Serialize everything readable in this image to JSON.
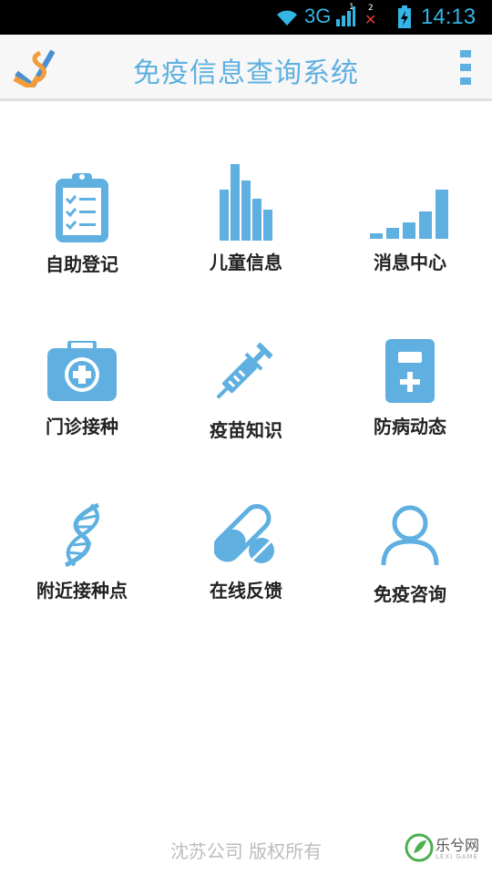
{
  "status_bar": {
    "network": "3G",
    "time": "14:13",
    "sim1": "1",
    "sim2": "2"
  },
  "app_bar": {
    "title": "免疫信息查询系统"
  },
  "tiles": [
    {
      "label": "自助登记",
      "icon": "clipboard-checklist-icon"
    },
    {
      "label": "儿童信息",
      "icon": "bar-chart-icon"
    },
    {
      "label": "消息中心",
      "icon": "ascending-bars-icon"
    },
    {
      "label": "门诊接种",
      "icon": "medical-kit-icon"
    },
    {
      "label": "疫苗知识",
      "icon": "syringe-icon"
    },
    {
      "label": "防病动态",
      "icon": "medical-device-icon"
    },
    {
      "label": "附近接种点",
      "icon": "dna-icon"
    },
    {
      "label": "在线反馈",
      "icon": "pill-icon"
    },
    {
      "label": "免疫咨询",
      "icon": "person-icon"
    }
  ],
  "footer": {
    "copyright": "沈苏公司 版权所有"
  },
  "watermark": {
    "text": "乐兮网",
    "subtext": "LEXI GAME"
  },
  "colors": {
    "accent": "#5fb0e0",
    "statusbar": "#000000"
  }
}
